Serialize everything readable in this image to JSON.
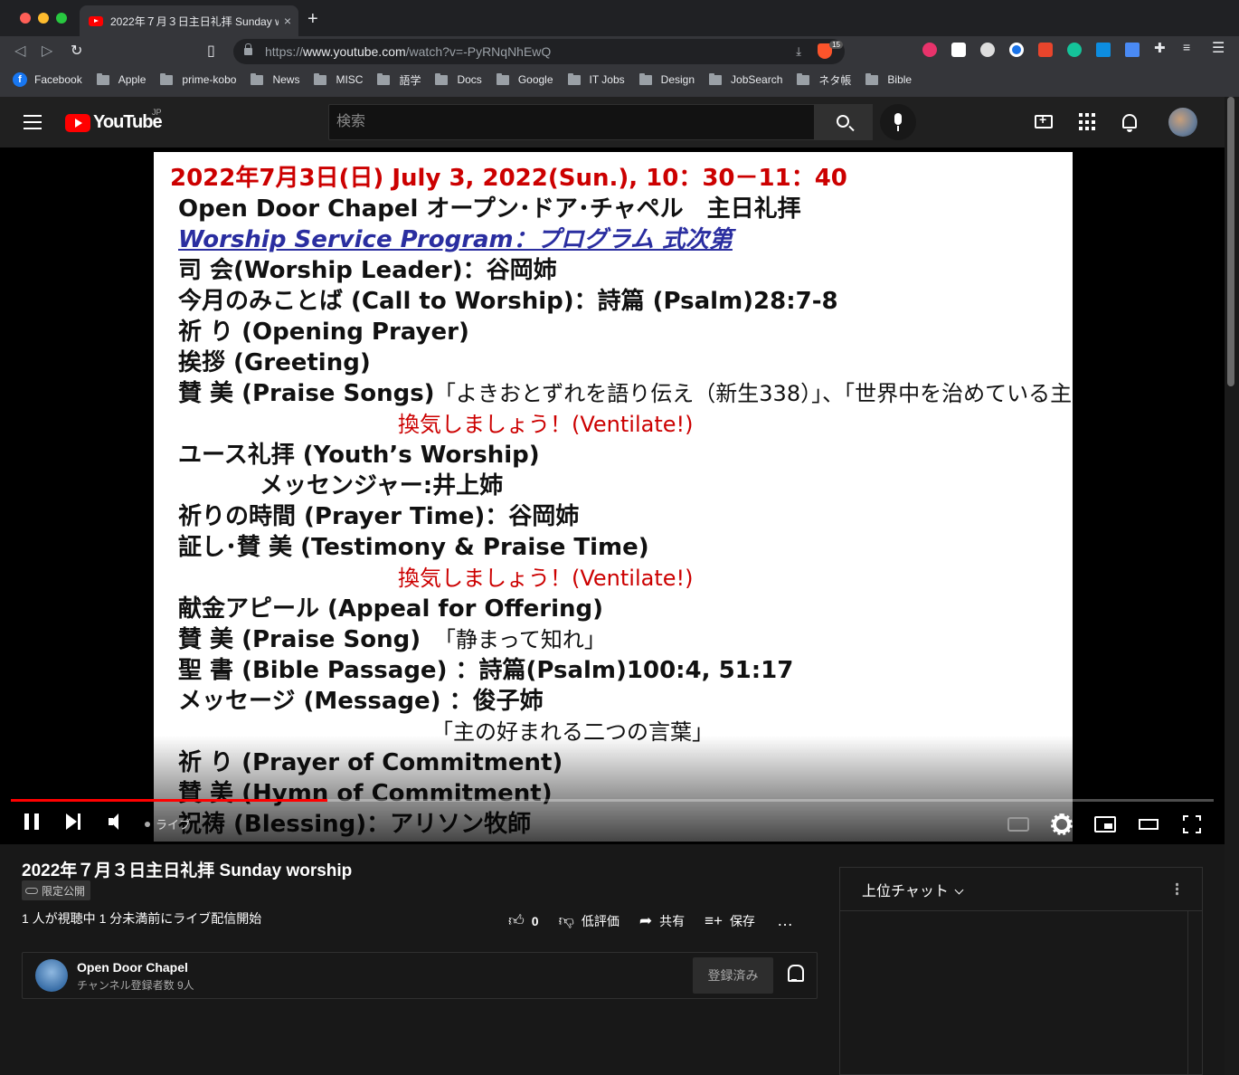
{
  "browser": {
    "tab_title": "2022年７月３日主日礼拝 Sunday worship",
    "tab_close": "×",
    "new_tab": "+",
    "url_scheme": "https://",
    "url_host": "www.youtube.com",
    "url_path": "/watch?v=-PyRNqNhEwQ",
    "brave_badge": "15",
    "bookmarks": [
      {
        "label": "Facebook",
        "icon": "facebook-icon"
      },
      {
        "label": "Apple",
        "icon": "folder-icon"
      },
      {
        "label": "prime-kobo",
        "icon": "folder-icon"
      },
      {
        "label": "News",
        "icon": "folder-icon"
      },
      {
        "label": "MISC",
        "icon": "folder-icon"
      },
      {
        "label": "語学",
        "icon": "folder-icon"
      },
      {
        "label": "Docs",
        "icon": "folder-icon"
      },
      {
        "label": "Google",
        "icon": "folder-icon"
      },
      {
        "label": "IT Jobs",
        "icon": "folder-icon"
      },
      {
        "label": "Design",
        "icon": "folder-icon"
      },
      {
        "label": "JobSearch",
        "icon": "folder-icon"
      },
      {
        "label": "ネタ帳",
        "icon": "folder-icon"
      },
      {
        "label": "Bible",
        "icon": "folder-icon"
      }
    ]
  },
  "youtube": {
    "logo_text": "YouTube",
    "region": "JP",
    "search_placeholder": "検索"
  },
  "slide": {
    "lines": [
      "2022年7月3日(日) July 3, 2022(Sun.), 10：30－11：40",
      "Open Door Chapel オープン･ドア･チャペル　主日礼拝",
      "Worship Service Program：プログラム 式次第",
      "司 会(Worship Leader)：谷岡姉",
      "今月のみことば (Call to Worship)：詩篇 (Psalm)28:7-8",
      "祈 り (Opening Prayer)",
      "挨拶 (Greeting)",
      "賛 美 (Praise Songs)",
      "「よきおとずれを語り伝え（新生338）」、「世界中を治めている主」",
      "換気しましょう！(Ventilate!)",
      "ユース礼拝 (Youth’s Worship)",
      "メッセンジャー:井上姉",
      "祈りの時間 (Prayer Time)：谷岡姉",
      "証し･賛 美 (Testimony & Praise Time)",
      "換気しましょう！(Ventilate!)",
      "献金アピール (Appeal for Offering)",
      "賛 美 (Praise Song)",
      "「静まって知れ」",
      "聖 書 (Bible Passage) ：詩篇(Psalm)100:4, 51:17",
      "メッセージ (Message) ：俊子姉",
      "「主の好まれる二つの言葉」",
      "祈 り (Prayer of Commitment)",
      "賛 美 (Hymn of Commitment)",
      "祝祷 (Blessing)：アリソン牧師"
    ]
  },
  "player": {
    "live_label": "ライブ",
    "progress": 0.263
  },
  "video": {
    "title": "2022年７月３日主日礼拝 Sunday worship",
    "privacy": "限定公開",
    "viewers": "1 人が視聴中  1 分未満前にライブ配信開始",
    "like_count": "0",
    "dislike_label": "低評価",
    "share_label": "共有",
    "save_label": "保存",
    "more_label": "…"
  },
  "channel": {
    "name": "Open Door Chapel",
    "subscribers": "チャンネル登録者数 9人",
    "subscribe_label": "登録済み"
  },
  "chat": {
    "mode_label": "上位チャット"
  },
  "colors": {
    "accent": "#ff0000",
    "slide_red": "#cc0000",
    "slide_blue": "#2a2ea0",
    "background": "#0f0f0f"
  }
}
